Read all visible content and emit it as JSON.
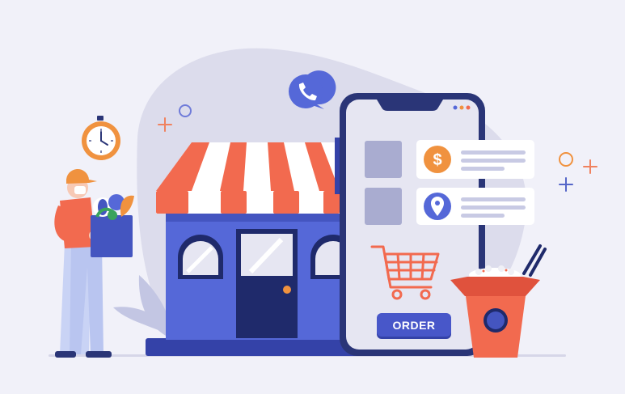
{
  "order_button": {
    "label": "ORDER"
  },
  "colors": {
    "background": "#f1f1f9",
    "blob": "#dcdcec",
    "store_blue": "#5568d8",
    "navy": "#1f2a6b",
    "stripe_red": "#f26a4f",
    "orange": "#f0923f",
    "phone_frame": "#2a3577",
    "phone_screen": "#e6e6f2"
  },
  "icons": [
    "phone-call-icon",
    "dollar-icon",
    "location-pin-icon",
    "shopping-cart-icon",
    "clock-icon"
  ]
}
